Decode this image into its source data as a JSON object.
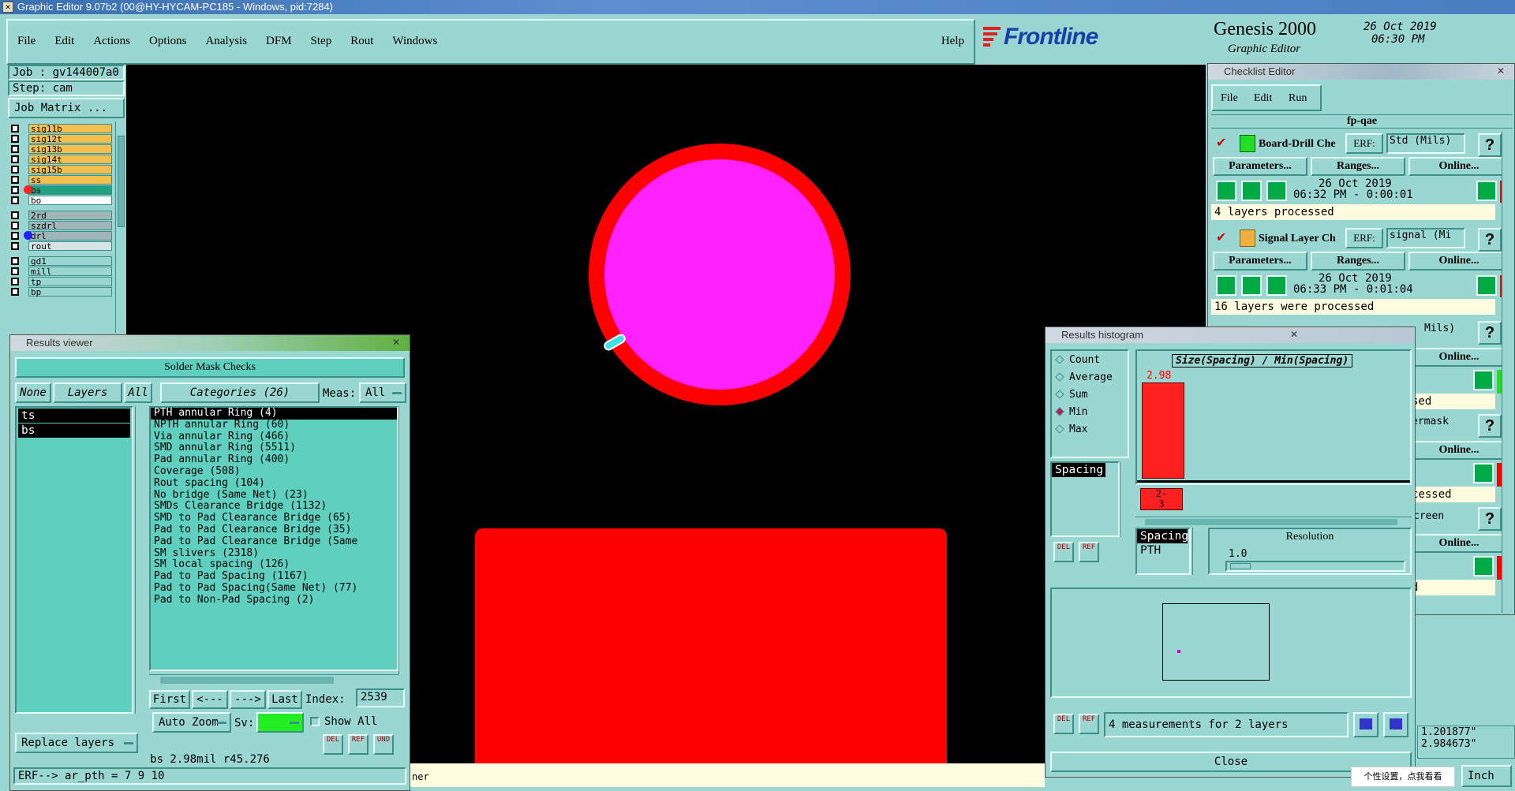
{
  "app": {
    "title": "Graphic Editor 9.07b2 (00@HY-HYCAM-PC185 - Windows, pid:7284)",
    "menu": [
      "File",
      "Edit",
      "Actions",
      "Options",
      "Analysis",
      "DFM",
      "Step",
      "Rout",
      "Windows"
    ],
    "help": "Help",
    "brand": "Frontline",
    "product": "Genesis 2000",
    "subtitle": "Graphic Editor",
    "date": "26 Oct 2019",
    "time": "06:30 PM"
  },
  "job": {
    "job_label": "Job : gv144007a0",
    "step_label": "Step: cam",
    "matrix_button": "Job Matrix ...",
    "layers": [
      {
        "name": "sig11b",
        "color": "#f5bf4f"
      },
      {
        "name": "sig12t",
        "color": "#f5bf4f"
      },
      {
        "name": "sig13b",
        "color": "#f5bf4f"
      },
      {
        "name": "sig14t",
        "color": "#f5bf4f"
      },
      {
        "name": "sig15b",
        "color": "#f5bf4f"
      },
      {
        "name": "ss",
        "color": "#f5bf4f"
      },
      {
        "name": "bs",
        "color": "#1fa080"
      },
      {
        "name": "bo",
        "color": "#ffffff"
      },
      {
        "name": "2rd",
        "color": "#9fb7b8"
      },
      {
        "name": "szdrl",
        "color": "#9fb7b8"
      },
      {
        "name": "drl",
        "color": "#9fb7b8"
      },
      {
        "name": "rout",
        "color": "#d8e4e4"
      },
      {
        "name": "gd1",
        "color": "#9ad7d3"
      },
      {
        "name": "mill",
        "color": "#9ad7d3"
      },
      {
        "name": "tp",
        "color": "#9ad7d3"
      },
      {
        "name": "bp",
        "color": "#9ad7d3"
      }
    ]
  },
  "results_viewer": {
    "title": "Results viewer",
    "heading": "Solder Mask Checks",
    "none_btn": "None",
    "layers_btn": "Layers",
    "all_btn": "All",
    "categories_btn": "Categories (26)",
    "meas_label": "Meas:",
    "meas_value": "All",
    "layer_list": [
      "ts",
      "bs"
    ],
    "categories": [
      "PTH annular Ring (4)",
      "NPTH annular Ring (60)",
      "Via annular Ring (466)",
      "SMD annular Ring (5511)",
      "Pad annular Ring (400)",
      "Coverage (508)",
      "Rout spacing (104)",
      "No bridge (Same Net) (23)",
      "SMDs Clearance Bridge (1132)",
      "SMD to Pad Clearance Bridge (65)",
      "Pad to Pad Clearance Bridge (35)",
      "Pad to Pad Clearance Bridge (Same",
      "SM slivers (2318)",
      "SM local spacing (126)",
      "Pad to Pad Spacing (1167)",
      "Pad to Pad Spacing(Same Net) (77)",
      "Pad to Non-Pad Spacing (2)"
    ],
    "first": "First",
    "prev": "<---",
    "next": "--->",
    "last": "Last",
    "index_label": "Index:",
    "index_value": "2539",
    "auto_zoom": "Auto Zoom",
    "sv_label": "Sv:",
    "show_all": "Show All",
    "replace_layers": "Replace layers",
    "status": "bs 2.98mil  r45.276",
    "erf_line": "ERF--> ar_pth = 7 9 10",
    "del": "DEL",
    "ref": "REF",
    "und": "UND"
  },
  "checklist": {
    "title": "Checklist Editor",
    "menu": [
      "File",
      "Edit",
      "Run"
    ],
    "name": "fp-qae",
    "items": [
      {
        "label": "Board-Drill Che",
        "erf": "ERF:",
        "erf_value": "Std (Mils)",
        "params": "Parameters...",
        "ranges": "Ranges...",
        "online": "Online...",
        "date": "26 Oct 2019",
        "time": "06:32 PM - 0:00:01",
        "status": "4 layers processed"
      },
      {
        "label": "Signal Layer Ch",
        "erf": "ERF:",
        "erf_value": "signal (Mi",
        "params": "Parameters...",
        "ranges": "Ranges...",
        "online": "Online...",
        "date": "26 Oct 2019",
        "time": "06:33 PM - 0:01:04",
        "status": "16 layers were processed"
      }
    ],
    "partial": [
      "Mils)",
      "Online...",
      "sed",
      "ermask",
      "Online...",
      "cessed",
      "creen",
      "Online...",
      "d"
    ],
    "help": "?"
  },
  "histogram": {
    "title": "Results histogram",
    "modes": [
      "Count",
      "Average",
      "Sum",
      "Min",
      "Max"
    ],
    "selected_mode": "Min",
    "chart_title": "Size(Spacing) / Min(Spacing)",
    "bar_value": "2.98",
    "bar_label": "2-\n3",
    "list": [
      "Spacing"
    ],
    "list2": [
      "Spacing",
      "PTH"
    ],
    "resolution_label": "Resolution",
    "resolution_value": "1.0",
    "measurements": "4 measurements for 2 layers",
    "close": "Close",
    "del": "DEL",
    "ref": "REF"
  },
  "status_bar": {
    "partial": "ner",
    "coord_x": "1.201877\"",
    "coord_y": "2.984673\"",
    "units": "Inch",
    "ime_tip": "个性设置，点我看看"
  },
  "colors": {
    "panel": "#9ad7d3",
    "list": "#5fd0bf",
    "canvas": "#000000",
    "feature_red": "#ff0000",
    "pad_magenta": "#ff22ff"
  }
}
